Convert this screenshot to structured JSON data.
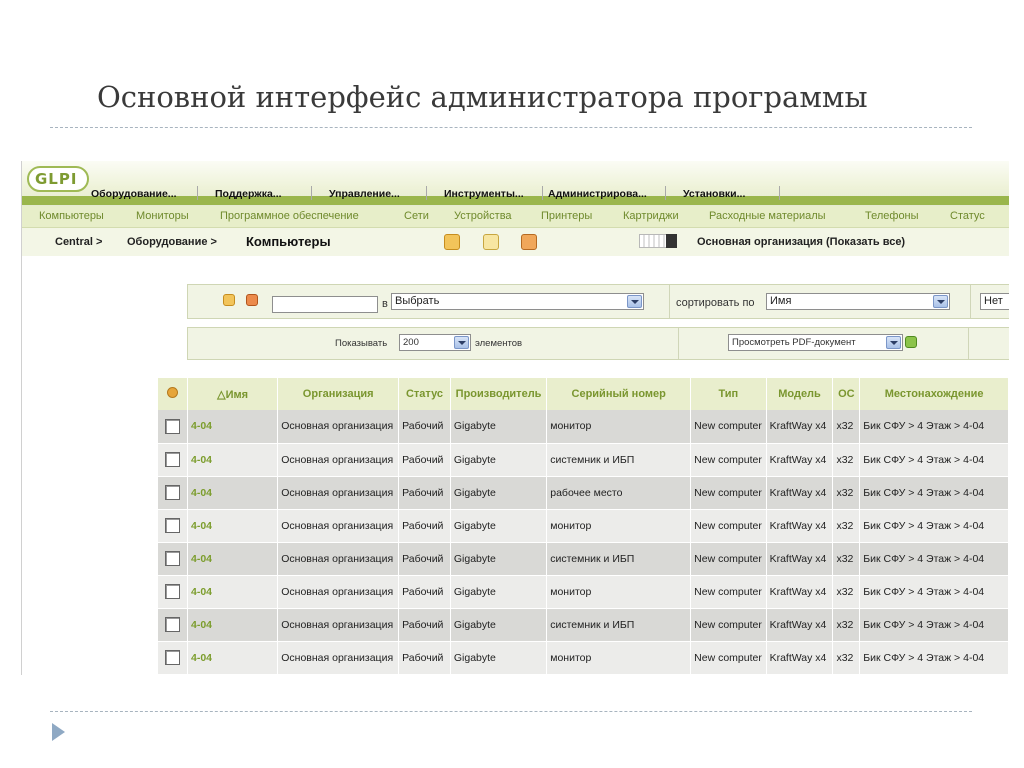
{
  "slide": {
    "title": "Основной интерфейс администратора программы"
  },
  "app": {
    "logo": "GLPI",
    "colors": {
      "accent": "#9ab64c",
      "link": "#7c9d2d",
      "header_bg": "#e9eecd"
    }
  },
  "menu": [
    "Оборудование...",
    "Поддержка...",
    "Управление...",
    "Инструменты...",
    "Администрирова...",
    "Установки..."
  ],
  "submenu": [
    "Компьютеры",
    "Мониторы",
    "Программное обеспечение",
    "Сети",
    "Устройства",
    "Принтеры",
    "Картриджи",
    "Расходные материалы",
    "Телефоны",
    "Статус"
  ],
  "breadcrumb": {
    "root": "Central >",
    "section": "Оборудование >",
    "current": "Компьютеры",
    "entity": "Основная организация (Показать все)"
  },
  "search": {
    "in_label": "в",
    "field_select": "Выбрать",
    "sort_label": "сортировать по",
    "sort_select": "Имя",
    "extra_select": "Нет",
    "show_label": "Показывать",
    "show_count": "200",
    "items_label": "элементов",
    "export_select": "Просмотреть PDF-документ"
  },
  "table": {
    "columns": [
      "△Имя",
      "Организация",
      "Статус",
      "Производитель",
      "Серийный номер",
      "Тип",
      "Модель",
      "ОС",
      "Местонахождение"
    ],
    "rows": [
      {
        "name": "4-04",
        "org": "Основная организация",
        "status": "Рабочий",
        "maker": "Gigabyte",
        "serial": "монитор",
        "type": "New computer",
        "model": "KraftWay x4",
        "os": "x32",
        "location": "Бик СФУ > 4 Этаж > 4-04"
      },
      {
        "name": "4-04",
        "org": "Основная организация",
        "status": "Рабочий",
        "maker": "Gigabyte",
        "serial": "системник и ИБП",
        "type": "New computer",
        "model": "KraftWay x4",
        "os": "x32",
        "location": "Бик СФУ > 4 Этаж > 4-04"
      },
      {
        "name": "4-04",
        "org": "Основная организация",
        "status": "Рабочий",
        "maker": "Gigabyte",
        "serial": "рабочее место",
        "type": "New computer",
        "model": "KraftWay x4",
        "os": "x32",
        "location": "Бик СФУ > 4 Этаж > 4-04"
      },
      {
        "name": "4-04",
        "org": "Основная организация",
        "status": "Рабочий",
        "maker": "Gigabyte",
        "serial": "монитор",
        "type": "New computer",
        "model": "KraftWay x4",
        "os": "x32",
        "location": "Бик СФУ > 4 Этаж > 4-04"
      },
      {
        "name": "4-04",
        "org": "Основная организация",
        "status": "Рабочий",
        "maker": "Gigabyte",
        "serial": "системник и ИБП",
        "type": "New computer",
        "model": "KraftWay x4",
        "os": "x32",
        "location": "Бик СФУ > 4 Этаж > 4-04"
      },
      {
        "name": "4-04",
        "org": "Основная организация",
        "status": "Рабочий",
        "maker": "Gigabyte",
        "serial": "монитор",
        "type": "New computer",
        "model": "KraftWay x4",
        "os": "x32",
        "location": "Бик СФУ > 4 Этаж > 4-04"
      },
      {
        "name": "4-04",
        "org": "Основная организация",
        "status": "Рабочий",
        "maker": "Gigabyte",
        "serial": "системник и ИБП",
        "type": "New computer",
        "model": "KraftWay x4",
        "os": "x32",
        "location": "Бик СФУ > 4 Этаж > 4-04"
      },
      {
        "name": "4-04",
        "org": "Основная организация",
        "status": "Рабочий",
        "maker": "Gigabyte",
        "serial": "монитор",
        "type": "New computer",
        "model": "KraftWay x4",
        "os": "x32",
        "location": "Бик СФУ > 4 Этаж > 4-04"
      }
    ]
  }
}
